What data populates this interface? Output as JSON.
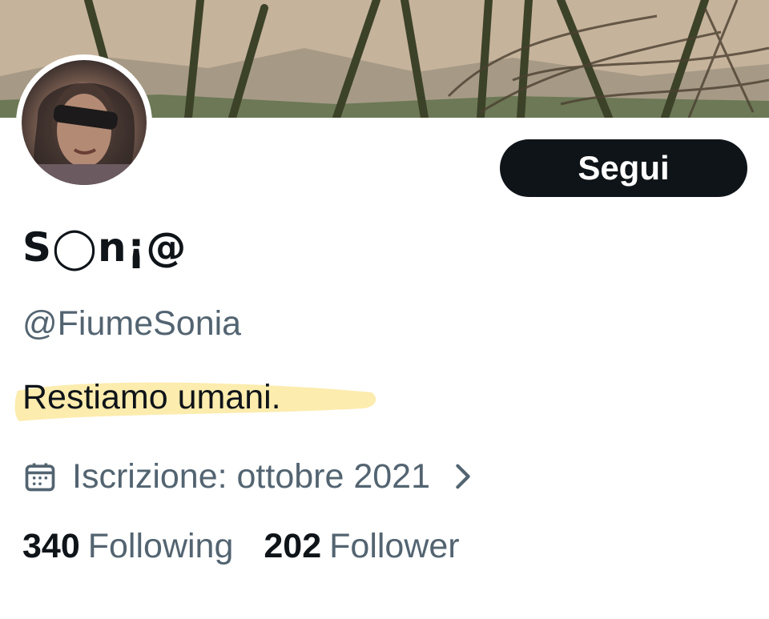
{
  "profile": {
    "display_name": "S◯n¡@",
    "handle": "@FiumeSonia",
    "bio": "Restiamo umani.",
    "joined": "Iscrizione: ottobre 2021",
    "follow_button": "Segui",
    "following_count": "340",
    "following_label": "Following",
    "followers_count": "202",
    "followers_label": "Follower"
  },
  "icons": {
    "calendar": "calendar-icon",
    "chevron": "chevron-right-icon"
  },
  "colors": {
    "text_primary": "#0f1419",
    "text_secondary": "#536471",
    "button_bg": "#0f1419",
    "highlight": "#fbe9a0"
  }
}
